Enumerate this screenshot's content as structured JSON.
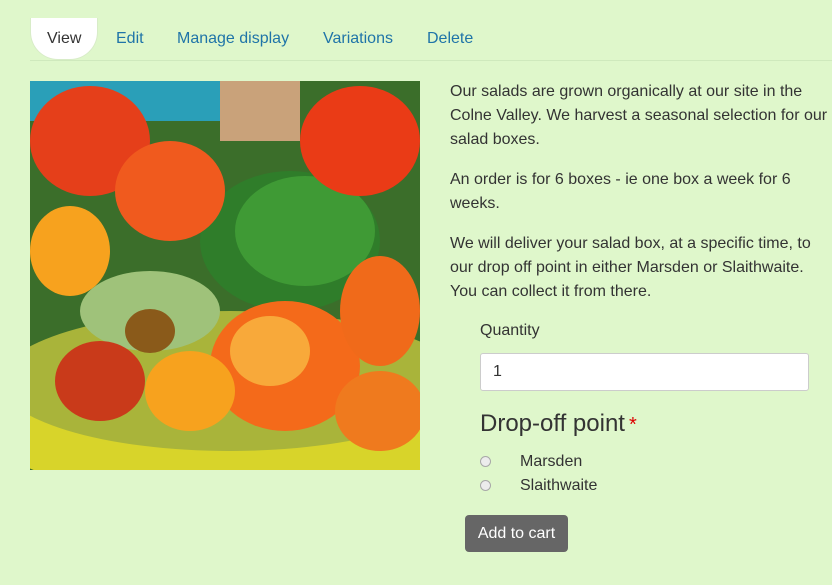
{
  "tabs": [
    {
      "label": "View",
      "active": true
    },
    {
      "label": "Edit"
    },
    {
      "label": "Manage display"
    },
    {
      "label": "Variations"
    },
    {
      "label": "Delete"
    }
  ],
  "product": {
    "description": [
      "Our salads are grown organically at our site in the Colne Valley. We harvest a seasonal selection for our salad boxes.",
      "An order is for 6 boxes - ie one box a week for 6 weeks.",
      "We will deliver your salad box, at a specific time, to our drop off point in either Marsden or Slaithwaite. You can collect it from there."
    ]
  },
  "form": {
    "quantity_label": "Quantity",
    "quantity_value": "1",
    "dropoff_title": "Drop-off point",
    "required_mark": "*",
    "options": [
      "Marsden",
      "Slaithwaite"
    ],
    "submit_label": "Add to cart"
  },
  "colors": {
    "background": "#dff7cb",
    "link": "#1f74a8",
    "button": "#666666",
    "required": "#dd0000"
  }
}
